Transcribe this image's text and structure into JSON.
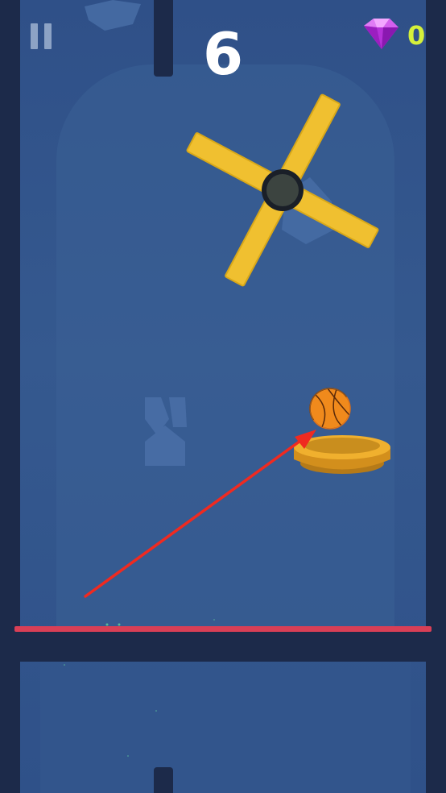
{
  "hud": {
    "score": "6",
    "gem_count": "0",
    "pause_icon": "pause-icon",
    "gem_icon": "purple-gem-icon"
  },
  "colors": {
    "background": "#35598f",
    "walls": "#1c2a4a",
    "floor_line": "#d93f56",
    "spinner": "#f0c030",
    "hoop": "#e9a524",
    "ball": "#f08a1c",
    "aim_arrow": "#f02a20",
    "gem": "#c13ee0",
    "gem_count": "#d5f03a"
  },
  "objects": {
    "spinner_icon": "x-spinner-obstacle",
    "hoop_icon": "basket-hoop",
    "ball_icon": "basketball",
    "arrow_icon": "aim-arrow"
  }
}
